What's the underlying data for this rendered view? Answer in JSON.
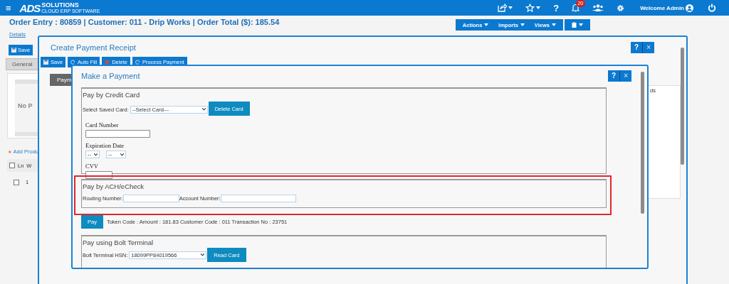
{
  "top_bar": {
    "menu_glyph": "≡",
    "logo": {
      "mark": "ADS",
      "name": "SOLUTIONS",
      "tagline": "CLOUD ERP SOFTWARE"
    },
    "help_glyph": "?",
    "notification_count": "20",
    "welcome": "Welcome Admin"
  },
  "page": {
    "title": "Order Entry  : 80859 | Customer: 011 - Drip Works | Order Total ($): 185.54",
    "details_link": "Details",
    "menus": [
      {
        "label": "Actions"
      },
      {
        "label": "Imports"
      },
      {
        "label": "Views"
      }
    ],
    "save_button": "Save",
    "tabs": [
      {
        "label": "General",
        "selected": false
      }
    ],
    "photo_placeholder": "No P",
    "add_link": "Add Produ",
    "columns": [
      "Ln",
      "W"
    ],
    "header_checkbox": {
      "checked": false
    },
    "rows": [
      {
        "number": "1",
        "checked": false
      }
    ]
  },
  "receipt_dialog": {
    "title": "Create Payment Receipt",
    "help": "?",
    "close": "×",
    "toolbar": [
      {
        "kind": "save",
        "label": "Save"
      },
      {
        "kind": "fill",
        "label": "Auto Fill"
      },
      {
        "kind": "delete",
        "label": "Delete"
      },
      {
        "kind": "process",
        "label": "Process Payment"
      }
    ],
    "tabs": [
      {
        "label": "Paym",
        "selected": true
      }
    ],
    "side_text": "ds"
  },
  "payment_dialog": {
    "title": "Make a Payment",
    "help": "?",
    "close": "×",
    "credit_card": {
      "legend": "Pay by Credit Card",
      "saved_card_label": "Select Saved Card:",
      "saved_card_value": "--Select Card---",
      "delete_button": "Delete Card",
      "card_number_label": "Card Number",
      "expiration_label": "Expiration Date",
      "month_value": "--",
      "year_value": "--",
      "cvv_label": "CVV"
    },
    "ach": {
      "legend": "Pay by ACH/eCheck",
      "routing_label": "Routing Number:",
      "account_label": "Account Number:",
      "highlighted": true
    },
    "pay_button": "Pay",
    "token_info": "Token Code : Amount : 181.83 Customer Code : 011 Transaction No : 23751",
    "bolt": {
      "legend": "Pay using Bolt Terminal",
      "hsn_label": "Bolt Terminal HSN:",
      "hsn_value": "18099PP84019566",
      "read_button": "Read Card"
    }
  }
}
